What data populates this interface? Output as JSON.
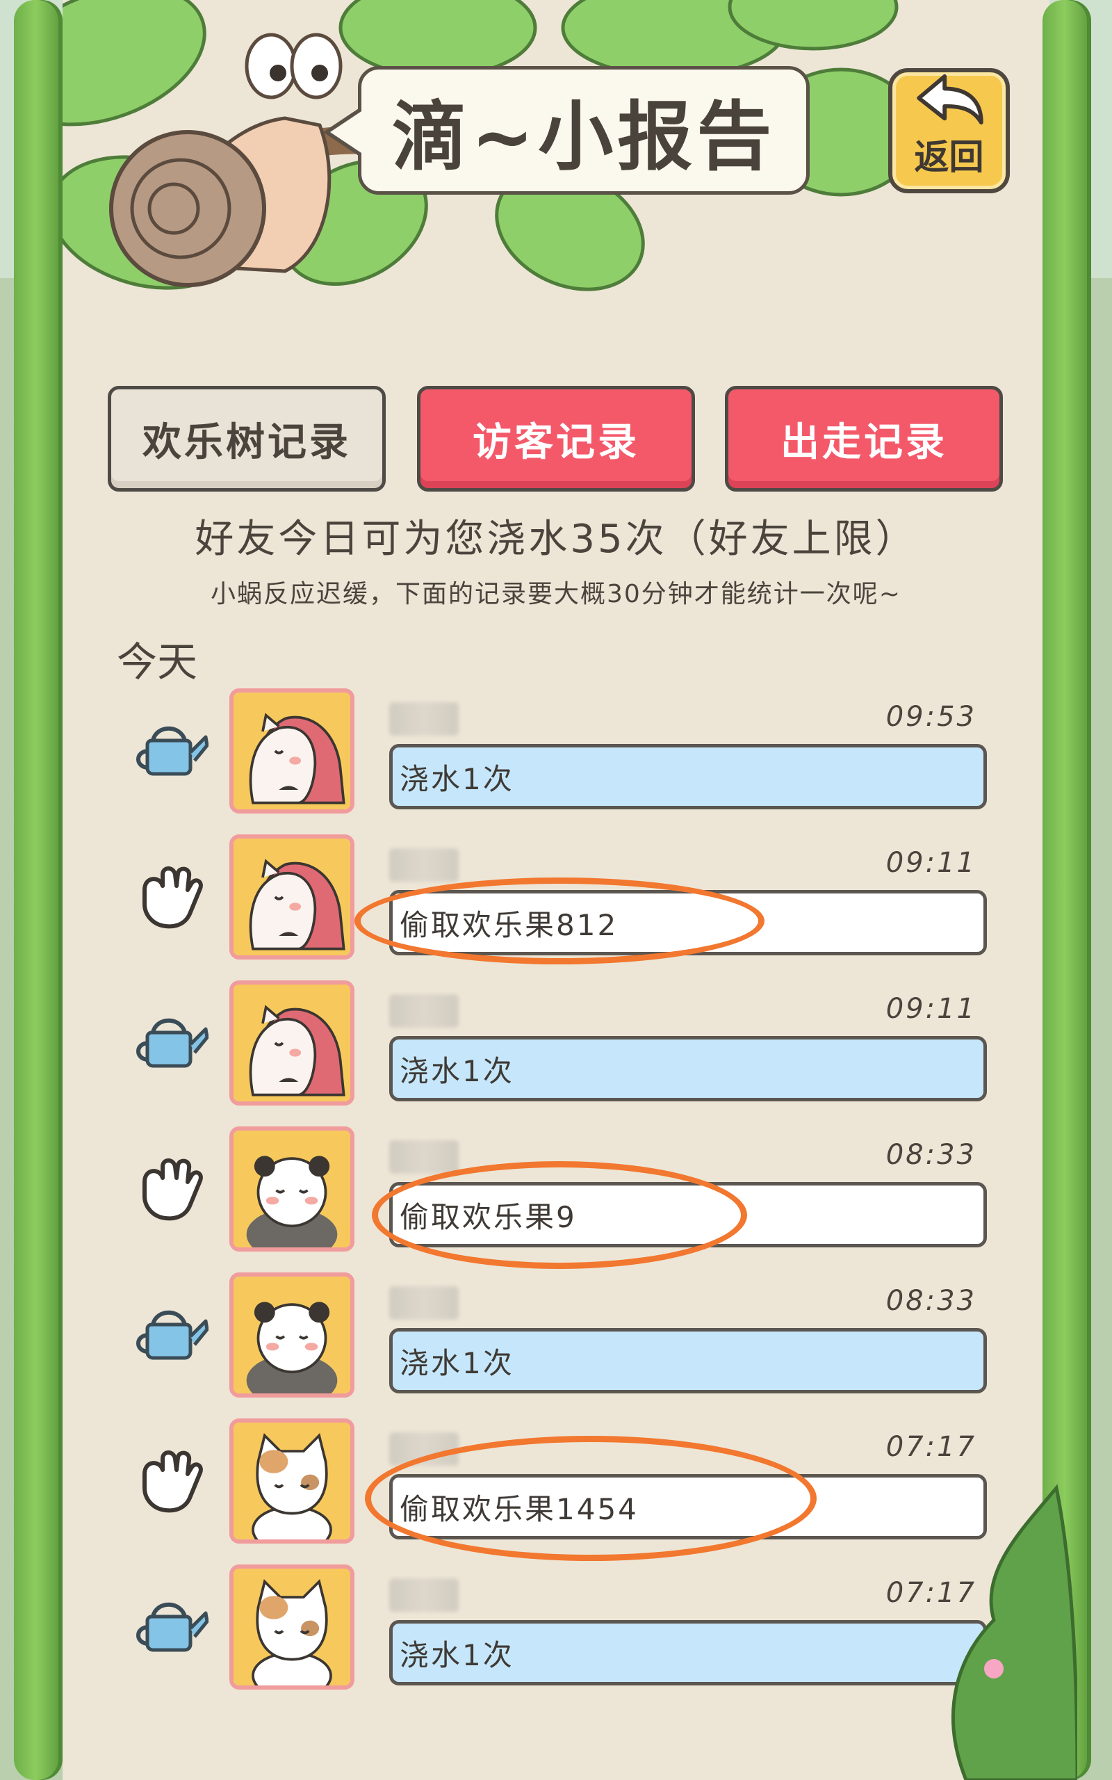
{
  "header": {
    "title": "滴~小报告",
    "back_label": "返回"
  },
  "tabs": [
    {
      "label": "欢乐树记录",
      "style": "gray"
    },
    {
      "label": "访客记录",
      "style": "red"
    },
    {
      "label": "出走记录",
      "style": "red"
    }
  ],
  "info": {
    "limit": "好友今日可为您浇水35次（好友上限）",
    "note": "小蜗反应迟缓，下面的记录要大概30分钟才能统计一次呢~"
  },
  "day_label": "今天",
  "records": [
    {
      "action": "watering-can-icon",
      "avatar": "hedgehog-avatar",
      "time": "09:53",
      "text": "浇水1次",
      "style": "blue"
    },
    {
      "action": "grab-hand-icon",
      "avatar": "hedgehog-avatar",
      "time": "09:11",
      "text": "偷取欢乐果812",
      "style": "white"
    },
    {
      "action": "watering-can-icon",
      "avatar": "hedgehog-avatar",
      "time": "09:11",
      "text": "浇水1次",
      "style": "blue"
    },
    {
      "action": "grab-hand-icon",
      "avatar": "panda-avatar",
      "time": "08:33",
      "text": "偷取欢乐果9",
      "style": "white"
    },
    {
      "action": "watering-can-icon",
      "avatar": "panda-avatar",
      "time": "08:33",
      "text": "浇水1次",
      "style": "blue"
    },
    {
      "action": "grab-hand-icon",
      "avatar": "cat-avatar",
      "time": "07:17",
      "text": "偷取欢乐果1454",
      "style": "white"
    },
    {
      "action": "watering-can-icon",
      "avatar": "cat-avatar",
      "time": "07:17",
      "text": "浇水1次",
      "style": "blue"
    }
  ],
  "colors": {
    "panel": "#ede6d6",
    "tab_red": "#f4596a",
    "water_bar": "#c6e7fb",
    "highlight_ring": "#f2772f",
    "vine": "#7dbf55"
  }
}
